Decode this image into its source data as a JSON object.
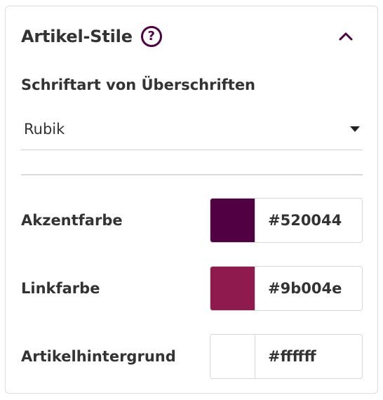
{
  "panel": {
    "title": "Artikel-Stile",
    "help_icon": "question-circle-icon",
    "collapse_icon": "chevron-up-icon",
    "accent_icon_color": "#520044"
  },
  "heading_font": {
    "label": "Schriftart von Überschriften",
    "selected": "Rubik",
    "dropdown_icon": "caret-down-icon"
  },
  "colors": [
    {
      "label": "Akzentfarbe",
      "hex": "#520044",
      "swatch": "#520044"
    },
    {
      "label": "Linkfarbe",
      "hex": "#9b004e",
      "swatch": "#8f1a4e"
    },
    {
      "label": "Artikelhintergrund",
      "hex": "#ffffff",
      "swatch": "#ffffff"
    }
  ]
}
